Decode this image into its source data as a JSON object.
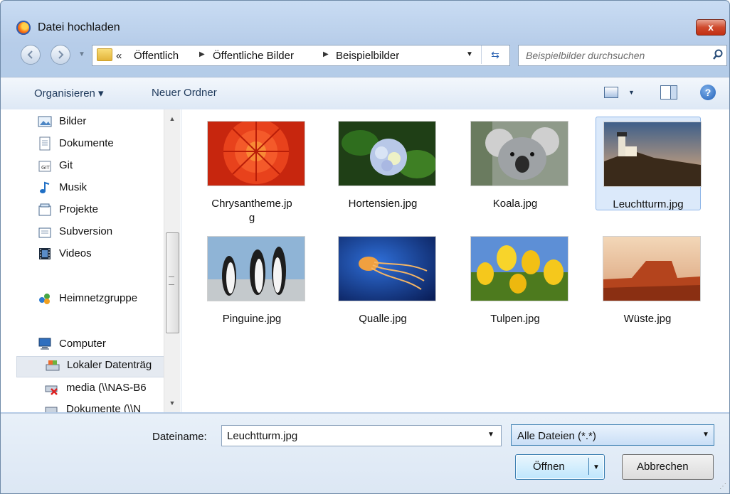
{
  "window": {
    "title": "Datei hochladen",
    "close_label": "x"
  },
  "address": {
    "crumbs": [
      "«",
      "Öffentlich",
      "Öffentliche Bilder",
      "Beispielbilder"
    ]
  },
  "search": {
    "placeholder": "Beispielbilder durchsuchen"
  },
  "toolbar": {
    "organize_label": "Organisieren ▾",
    "new_folder_label": "Neuer Ordner",
    "help_label": "?"
  },
  "nav_pane": {
    "items": [
      {
        "label": "Bilder",
        "icon": "pictures-icon"
      },
      {
        "label": "Dokumente",
        "icon": "documents-icon"
      },
      {
        "label": "Git",
        "icon": "git-library-icon"
      },
      {
        "label": "Musik",
        "icon": "music-icon"
      },
      {
        "label": "Projekte",
        "icon": "library-icon"
      },
      {
        "label": "Subversion",
        "icon": "library-icon"
      },
      {
        "label": "Videos",
        "icon": "videos-icon"
      },
      {
        "label": "Heimnetzgruppe",
        "icon": "homegroup-icon"
      },
      {
        "label": "Computer",
        "icon": "computer-icon"
      },
      {
        "label": "Lokaler Datenträg",
        "icon": "local-disk-icon",
        "selected": true
      },
      {
        "label": "media (\\\\NAS-B6",
        "icon": "network-drive-disconnected-icon"
      },
      {
        "label": "Dokumente (\\\\N",
        "icon": "network-drive-icon"
      }
    ]
  },
  "files": [
    {
      "label": "Chrysantheme.jp\ng",
      "thumb": "chrysanthemum"
    },
    {
      "label": "Hortensien.jpg",
      "thumb": "hydrangeas"
    },
    {
      "label": "Koala.jpg",
      "thumb": "koala"
    },
    {
      "label": "Leuchtturm.jpg",
      "thumb": "lighthouse",
      "selected": true
    },
    {
      "label": "Pinguine.jpg",
      "thumb": "penguins"
    },
    {
      "label": "Qualle.jpg",
      "thumb": "jellyfish"
    },
    {
      "label": "Tulpen.jpg",
      "thumb": "tulips"
    },
    {
      "label": "Wüste.jpg",
      "thumb": "desert"
    }
  ],
  "footer": {
    "filename_label": "Dateiname:",
    "filename_value": "Leuchtturm.jpg",
    "filter_value": "Alle Dateien (*.*)",
    "open_label": "Öffnen",
    "cancel_label": "Abbrechen"
  }
}
